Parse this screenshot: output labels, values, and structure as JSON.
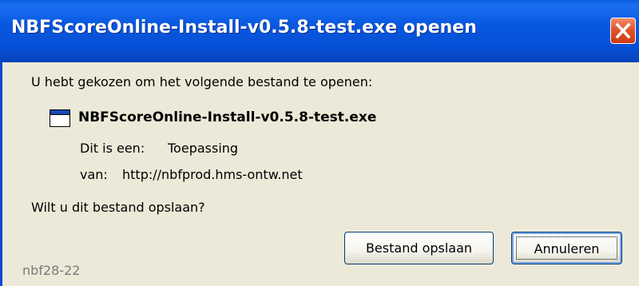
{
  "window": {
    "title": "NBFScoreOnline-Install-v0.5.8-test.exe openen",
    "close_icon": "close-icon"
  },
  "dialog": {
    "intro": "U hebt gekozen om het volgende bestand te openen:",
    "file": {
      "icon": "application-window-icon",
      "name": "NBFScoreOnline-Install-v0.5.8-test.exe",
      "type_label": "Dit is een:",
      "type_value": "Toepassing",
      "source_label": "van:",
      "source_value": "http://nbfprod.hms-ontw.net"
    },
    "question": "Wilt u dit bestand opslaan?"
  },
  "buttons": {
    "save_label": "Bestand opslaan",
    "cancel_label": "Annuleren"
  },
  "status_text": "nbf28-22",
  "colors": {
    "titlebar": "#0858e0",
    "body": "#ece9d8",
    "close_button": "#e2552a",
    "button_border": "#003c74"
  }
}
